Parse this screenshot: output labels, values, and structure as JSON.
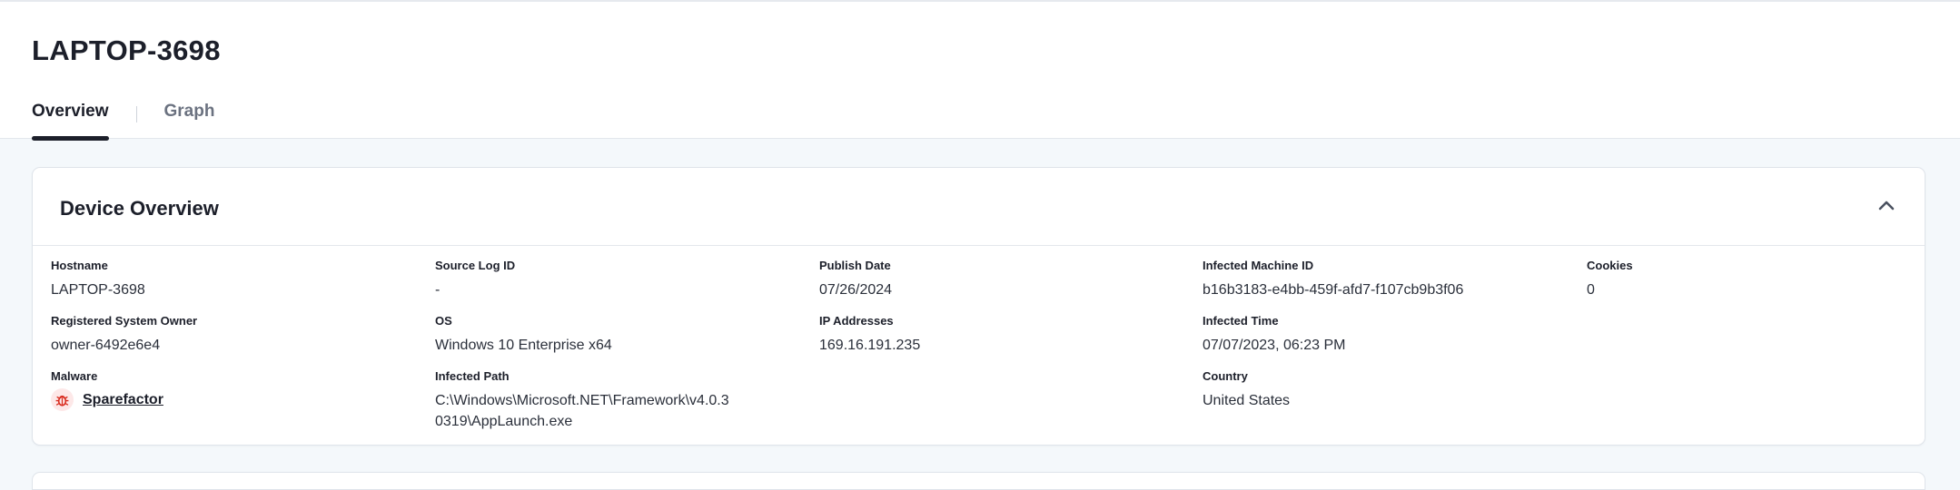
{
  "page": {
    "title": "LAPTOP-3698"
  },
  "tabs": [
    {
      "label": "Overview",
      "active": true
    },
    {
      "label": "Graph",
      "active": false
    }
  ],
  "device_overview": {
    "title": "Device Overview",
    "collapse_icon": "chevron-up-icon",
    "fields": {
      "hostname": {
        "label": "Hostname",
        "value": "LAPTOP-3698"
      },
      "source_log_id": {
        "label": "Source Log ID",
        "value": "-"
      },
      "publish_date": {
        "label": "Publish Date",
        "value": "07/26/2024"
      },
      "infected_machine_id": {
        "label": "Infected Machine ID",
        "value": "b16b3183-e4bb-459f-afd7-f107cb9b3f06"
      },
      "cookies": {
        "label": "Cookies",
        "value": "0"
      },
      "registered_owner": {
        "label": "Registered System Owner",
        "value": "owner-6492e6e4"
      },
      "os": {
        "label": "OS",
        "value": "Windows 10 Enterprise x64"
      },
      "ip_addresses": {
        "label": "IP Addresses",
        "value": "169.16.191.235"
      },
      "infected_time": {
        "label": "Infected Time",
        "value": "07/07/2023, 06:23 PM"
      },
      "malware": {
        "label": "Malware",
        "value": "Sparefactor",
        "icon": "bug-icon"
      },
      "infected_path": {
        "label": "Infected Path",
        "line1": "C:\\Windows\\Microsoft.NET\\Framework\\v4.0.3",
        "line2": "0319\\AppLaunch.exe"
      },
      "country": {
        "label": "Country",
        "value": "United States"
      }
    }
  },
  "colors": {
    "accent": "#1c1f2a",
    "page_bg": "#f4f8fb",
    "bug_red": "#d92d20"
  }
}
